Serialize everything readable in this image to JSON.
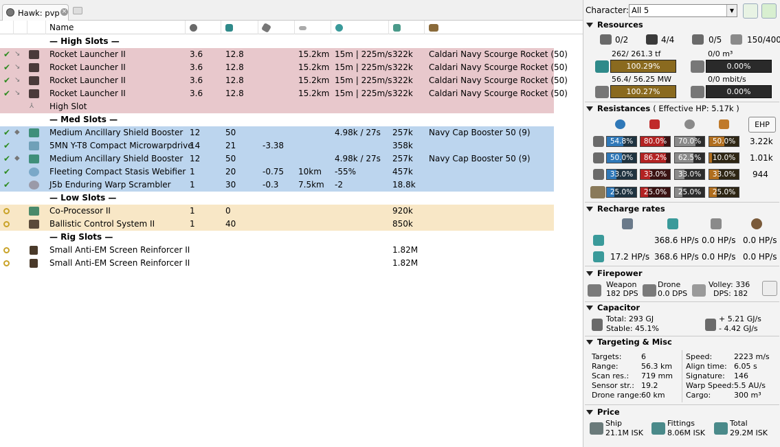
{
  "tab": {
    "title": "Hawk: pvp"
  },
  "columns": [
    "Name"
  ],
  "sections": {
    "high": "— High Slots —",
    "med": "— Med Slots —",
    "low": "— Low Slots —",
    "rig": "— Rig Slots —"
  },
  "high_slots": [
    {
      "name": "Rocket Launcher II",
      "cpu": "3.6",
      "pg": "12.8",
      "cap": "",
      "range": "15.2km",
      "speed": "15m | 225m/s",
      "price": "322k",
      "charge": "Caldari Navy Scourge Rocket (50)"
    },
    {
      "name": "Rocket Launcher II",
      "cpu": "3.6",
      "pg": "12.8",
      "cap": "",
      "range": "15.2km",
      "speed": "15m | 225m/s",
      "price": "322k",
      "charge": "Caldari Navy Scourge Rocket (50)"
    },
    {
      "name": "Rocket Launcher II",
      "cpu": "3.6",
      "pg": "12.8",
      "cap": "",
      "range": "15.2km",
      "speed": "15m | 225m/s",
      "price": "322k",
      "charge": "Caldari Navy Scourge Rocket (50)"
    },
    {
      "name": "Rocket Launcher II",
      "cpu": "3.6",
      "pg": "12.8",
      "cap": "",
      "range": "15.2km",
      "speed": "15m | 225m/s",
      "price": "322k",
      "charge": "Caldari Navy Scourge Rocket (50)"
    },
    {
      "name": "High Slot",
      "cpu": "",
      "pg": "",
      "cap": "",
      "range": "",
      "speed": "",
      "price": "",
      "charge": ""
    }
  ],
  "med_slots": [
    {
      "name": "Medium Ancillary Shield Booster",
      "cpu": "12",
      "pg": "50",
      "cap": "",
      "range": "",
      "speed": "4.98k / 27s",
      "price": "257k",
      "charge": "Navy Cap Booster 50 (9)"
    },
    {
      "name": "5MN Y-T8 Compact Microwarpdrive",
      "cpu": "14",
      "pg": "21",
      "cap": "-3.38",
      "range": "",
      "speed": "",
      "price": "358k",
      "charge": ""
    },
    {
      "name": "Medium Ancillary Shield Booster",
      "cpu": "12",
      "pg": "50",
      "cap": "",
      "range": "",
      "speed": "4.98k / 27s",
      "price": "257k",
      "charge": "Navy Cap Booster 50 (9)"
    },
    {
      "name": "Fleeting Compact Stasis Webifier",
      "cpu": "1",
      "pg": "20",
      "cap": "-0.75",
      "range": "10km",
      "speed": "-55%",
      "price": "457k",
      "charge": ""
    },
    {
      "name": "J5b Enduring Warp Scrambler",
      "cpu": "1",
      "pg": "30",
      "cap": "-0.3",
      "range": "7.5km",
      "speed": "-2",
      "price": "18.8k",
      "charge": ""
    }
  ],
  "low_slots": [
    {
      "name": "Co-Processor II",
      "cpu": "1",
      "pg": "0",
      "cap": "",
      "range": "",
      "speed": "",
      "price": "920k",
      "charge": ""
    },
    {
      "name": "Ballistic Control System II",
      "cpu": "1",
      "pg": "40",
      "cap": "",
      "range": "",
      "speed": "",
      "price": "850k",
      "charge": ""
    }
  ],
  "rig_slots": [
    {
      "name": "Small Anti-EM Screen Reinforcer II",
      "cpu": "",
      "pg": "",
      "cap": "",
      "range": "",
      "speed": "",
      "price": "1.82M",
      "charge": ""
    },
    {
      "name": "Small Anti-EM Screen Reinforcer II",
      "cpu": "",
      "pg": "",
      "cap": "",
      "range": "",
      "speed": "",
      "price": "1.82M",
      "charge": ""
    }
  ],
  "colors": {
    "high": "#e8c8cc",
    "med": "#bcd5ee",
    "low": "#f8e7c6",
    "check": "#2e8b20",
    "ring": "#c9a227"
  },
  "character": {
    "label": "Character:",
    "value": "All 5"
  },
  "resources": {
    "title": "Resources",
    "turrets": "0/2",
    "launchers": "4/4",
    "drones_bay": "0/5",
    "calibration": "150/400",
    "cpu_label": "262/ 261.3 tf",
    "cpu_pct": "100.29%",
    "cpu_fill": 100.29,
    "pg_label": "56.4/ 56.25 MW",
    "pg_pct": "100.27%",
    "pg_fill": 100.27,
    "drone_bay_label": "0/0 m³",
    "drone_bay_pct": "0.00%",
    "bandwidth_label": "0/0 mbit/s",
    "bandwidth_pct": "0.00%"
  },
  "resistances": {
    "title": "Resistances",
    "effective_hp": "( Effective HP: 5.17k )",
    "ehp_button": "EHP",
    "rows": [
      {
        "layer": "shield",
        "em": "54.8%",
        "em_v": 54.8,
        "thermal": "80.0%",
        "thermal_v": 80.0,
        "kinetic": "70.0%",
        "kinetic_v": 70.0,
        "explosive": "50.0%",
        "explosive_v": 50.0,
        "hp": "3.22k"
      },
      {
        "layer": "armor",
        "em": "50.0%",
        "em_v": 50.0,
        "thermal": "86.2%",
        "thermal_v": 86.2,
        "kinetic": "62.5%",
        "kinetic_v": 62.5,
        "explosive": "10.0%",
        "explosive_v": 10.0,
        "hp": "1.01k"
      },
      {
        "layer": "hull",
        "em": "33.0%",
        "em_v": 33.0,
        "thermal": "33.0%",
        "thermal_v": 33.0,
        "kinetic": "33.0%",
        "kinetic_v": 33.0,
        "explosive": "33.0%",
        "explosive_v": 33.0,
        "hp": "944"
      },
      {
        "layer": "damage-pattern",
        "em": "25.0%",
        "em_v": 25.0,
        "thermal": "25.0%",
        "thermal_v": 25.0,
        "kinetic": "25.0%",
        "kinetic_v": 25.0,
        "explosive": "25.0%",
        "explosive_v": 25.0,
        "hp": ""
      }
    ]
  },
  "recharge": {
    "title": "Recharge rates",
    "row1": [
      "",
      "368.6 HP/s",
      "0.0 HP/s",
      "0.0 HP/s"
    ],
    "row2": [
      "17.2 HP/s",
      "368.6 HP/s",
      "0.0 HP/s",
      "0.0 HP/s"
    ]
  },
  "firepower": {
    "title": "Firepower",
    "weapon_label": "Weapon",
    "weapon_dps": "182 DPS",
    "drone_label": "Drone",
    "drone_dps": "0.0 DPS",
    "volley": "Volley: 336",
    "dps": "DPS: 182"
  },
  "capacitor": {
    "title": "Capacitor",
    "total": "Total: 293 GJ",
    "stable": "Stable: 45.1%",
    "plus": "+ 5.21 GJ/s",
    "minus": "- 4.42 GJ/s"
  },
  "targeting": {
    "title": "Targeting & Misc",
    "left": [
      [
        "Targets:",
        "6"
      ],
      [
        "Range:",
        "56.3 km"
      ],
      [
        "Scan res.:",
        "719 mm"
      ],
      [
        "Sensor str.:",
        "19.2"
      ],
      [
        "Drone range:",
        "60 km"
      ]
    ],
    "right": [
      [
        "Speed:",
        "2223 m/s"
      ],
      [
        "Align time:",
        "6.05 s"
      ],
      [
        "Signature:",
        "146"
      ],
      [
        "Warp Speed:",
        "5.5 AU/s"
      ],
      [
        "Cargo:",
        "300 m³"
      ]
    ]
  },
  "price": {
    "title": "Price",
    "ship_label": "Ship",
    "ship": "21.1M ISK",
    "fittings_label": "Fittings",
    "fittings": "8.06M ISK",
    "total_label": "Total",
    "total": "29.2M ISK"
  }
}
